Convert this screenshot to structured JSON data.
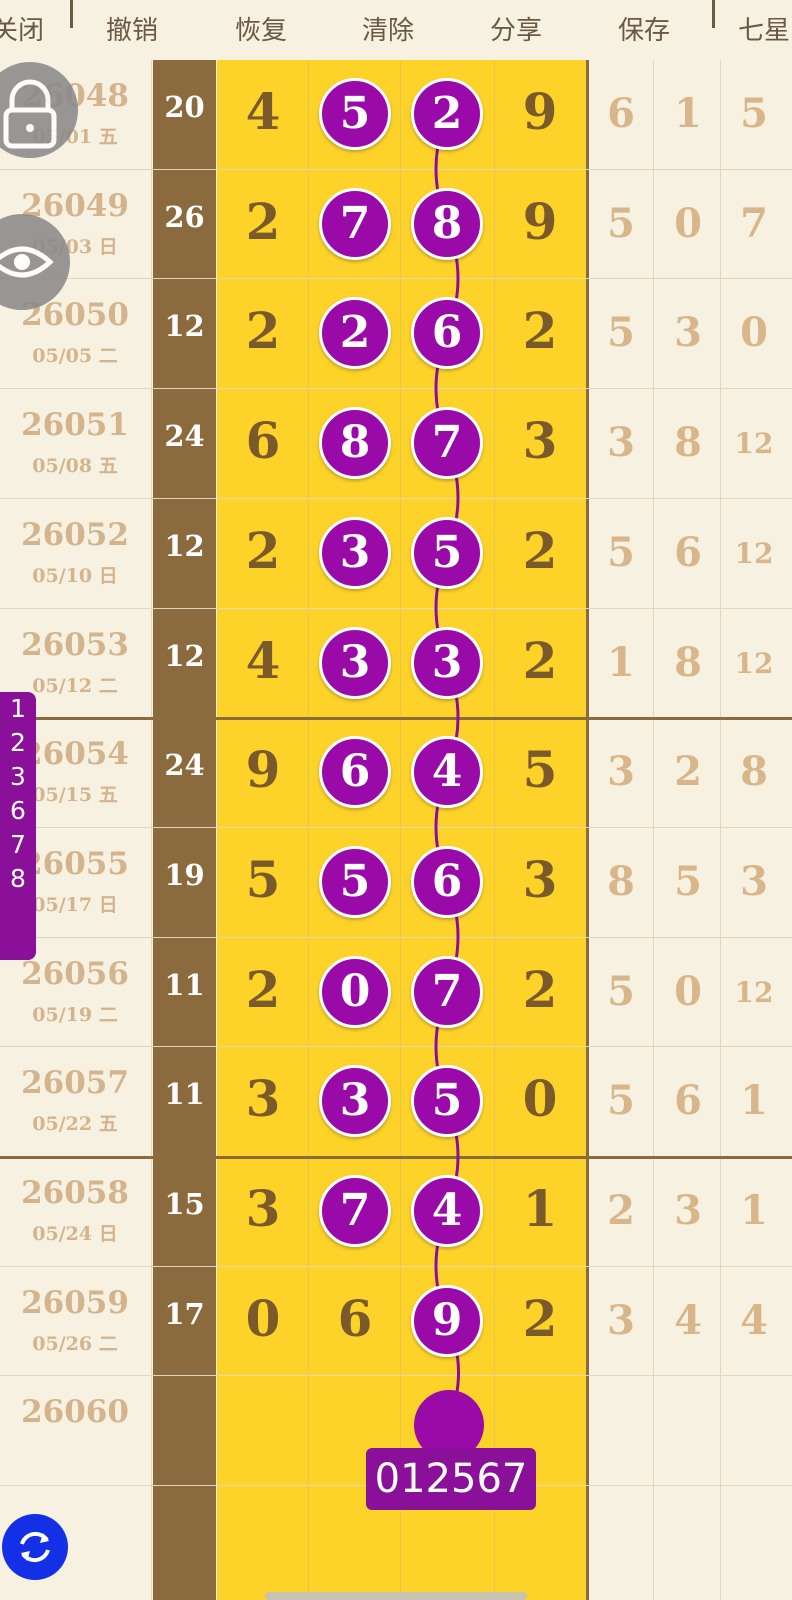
{
  "toolbar": {
    "close": "关闭",
    "undo": "撤销",
    "redo": "恢复",
    "clear": "清除",
    "share": "分享",
    "save": "保存",
    "seven_star": "七星"
  },
  "rows": [
    {
      "issue": "26048",
      "date": "05/01 五",
      "sum": "20",
      "d": [
        "4",
        "5",
        "2",
        "9"
      ],
      "e": [
        "6",
        "1",
        "5"
      ]
    },
    {
      "issue": "26049",
      "date": "05/03 日",
      "sum": "26",
      "d": [
        "2",
        "7",
        "8",
        "9"
      ],
      "e": [
        "5",
        "0",
        "7"
      ]
    },
    {
      "issue": "26050",
      "date": "05/05 二",
      "sum": "12",
      "d": [
        "2",
        "2",
        "6",
        "2"
      ],
      "e": [
        "5",
        "3",
        "0"
      ]
    },
    {
      "issue": "26051",
      "date": "05/08 五",
      "sum": "24",
      "d": [
        "6",
        "8",
        "7",
        "3"
      ],
      "e": [
        "3",
        "8",
        "12"
      ]
    },
    {
      "issue": "26052",
      "date": "05/10 日",
      "sum": "12",
      "d": [
        "2",
        "3",
        "5",
        "2"
      ],
      "e": [
        "5",
        "6",
        "12"
      ]
    },
    {
      "issue": "26053",
      "date": "05/12 二",
      "sum": "12",
      "d": [
        "4",
        "3",
        "3",
        "2"
      ],
      "e": [
        "1",
        "8",
        "12"
      ]
    },
    {
      "issue": "26054",
      "date": "05/15 五",
      "sum": "24",
      "d": [
        "9",
        "6",
        "4",
        "5"
      ],
      "e": [
        "3",
        "2",
        "8"
      ]
    },
    {
      "issue": "26055",
      "date": "05/17 日",
      "sum": "19",
      "d": [
        "5",
        "5",
        "6",
        "3"
      ],
      "e": [
        "8",
        "5",
        "3"
      ]
    },
    {
      "issue": "26056",
      "date": "05/19 二",
      "sum": "11",
      "d": [
        "2",
        "0",
        "7",
        "2"
      ],
      "e": [
        "5",
        "0",
        "12"
      ]
    },
    {
      "issue": "26057",
      "date": "05/22 五",
      "sum": "11",
      "d": [
        "3",
        "3",
        "5",
        "0"
      ],
      "e": [
        "5",
        "6",
        "1"
      ]
    },
    {
      "issue": "26058",
      "date": "05/24 日",
      "sum": "15",
      "d": [
        "3",
        "7",
        "4",
        "1"
      ],
      "e": [
        "2",
        "3",
        "1"
      ]
    },
    {
      "issue": "26059",
      "date": "05/26 二",
      "sum": "17",
      "d": [
        "0",
        "6",
        "9",
        "2"
      ],
      "e": [
        "3",
        "4",
        "4"
      ]
    },
    {
      "issue": "26060",
      "date": "",
      "sum": "",
      "d": [
        "",
        "",
        "",
        ""
      ],
      "e": [
        "",
        "",
        ""
      ]
    }
  ],
  "marked": [
    [
      1,
      2
    ],
    [
      1,
      2
    ],
    [
      1,
      2
    ],
    [
      1,
      2
    ],
    [
      1,
      2
    ],
    [
      1,
      2
    ],
    [
      1,
      2
    ],
    [
      1,
      2
    ],
    [
      1,
      2
    ],
    [
      1,
      2
    ],
    [
      1,
      2
    ],
    [
      2
    ],
    []
  ],
  "side_list": [
    "1",
    "2",
    "3",
    "6",
    "7",
    "8"
  ],
  "prediction": "012567",
  "colors": {
    "highlight": "#fdd32a",
    "ball": "#9a0aa8",
    "sum_column": "#8b6a3d",
    "refresh": "#1430e6"
  },
  "icons": {
    "lock": "lock-icon",
    "eye": "eye-icon",
    "refresh": "refresh-icon"
  }
}
